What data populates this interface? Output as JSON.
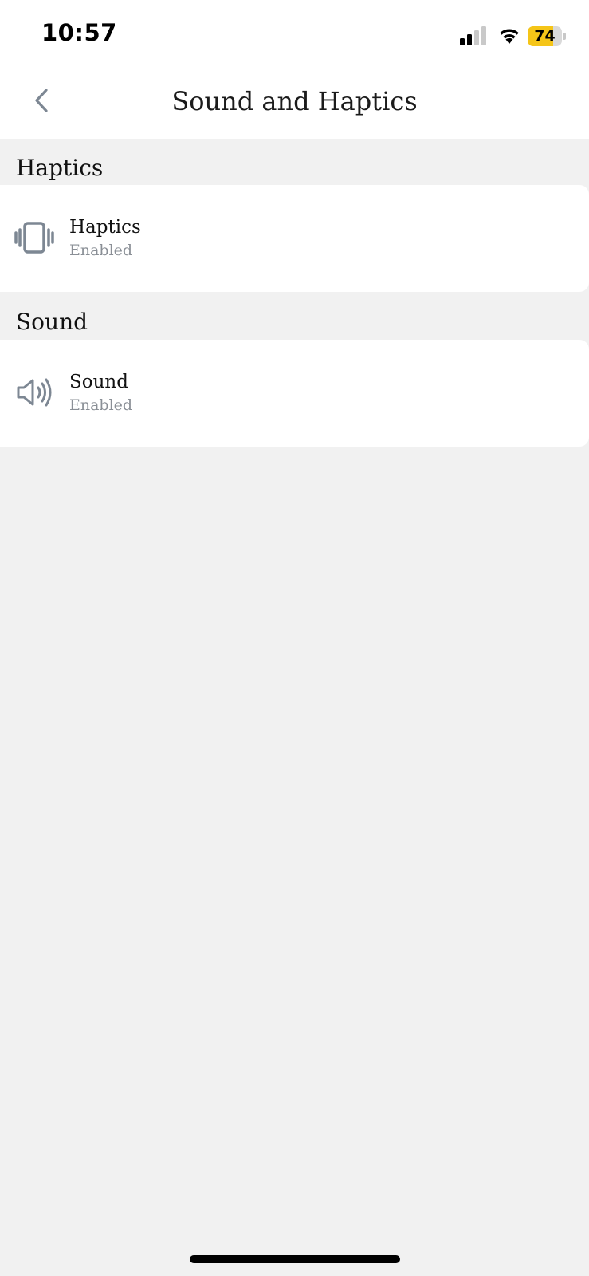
{
  "status_bar": {
    "time": "10:57",
    "battery_level": "74",
    "battery_color": "#f5c518"
  },
  "header": {
    "back_icon": "chevron-left-icon",
    "title": "Sound and Haptics"
  },
  "sections": [
    {
      "heading": "Haptics",
      "item": {
        "icon": "vibration-icon",
        "title": "Haptics",
        "status": "Enabled"
      }
    },
    {
      "heading": "Sound",
      "item": {
        "icon": "speaker-icon",
        "title": "Sound",
        "status": "Enabled"
      }
    }
  ],
  "colors": {
    "background": "#f1f1f1",
    "card": "#ffffff",
    "icon": "#7d8793",
    "subtitle": "#8a8f96"
  }
}
